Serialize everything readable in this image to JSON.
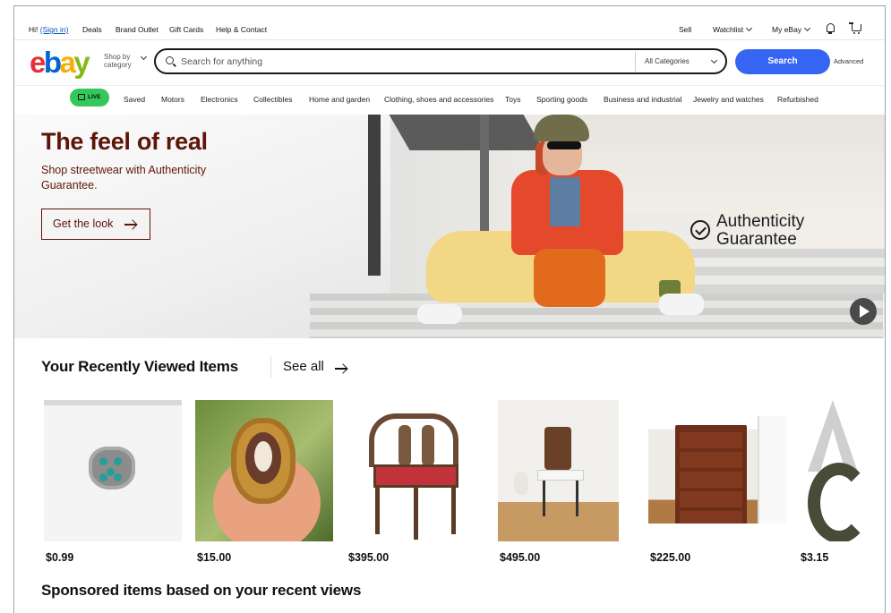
{
  "topbar": {
    "greeting": "Hi!",
    "signin": "(Sign in)",
    "deals": "Deals",
    "brand_outlet": "Brand Outlet",
    "gift_cards": "Gift Cards",
    "help": "Help & Contact",
    "sell": "Sell",
    "watchlist": "Watchlist",
    "my_ebay": "My eBay",
    "bell_icon": "bell-icon",
    "cart_icon": "cart-icon"
  },
  "header": {
    "logo": {
      "e": "e",
      "b": "b",
      "a": "a",
      "y": "y"
    },
    "shop_by_line1": "Shop by",
    "shop_by_line2": "category",
    "search_placeholder": "Search for anything",
    "search_value": "",
    "category_selected": "All Categories",
    "search_button": "Search",
    "advanced": "Advanced"
  },
  "nav": {
    "live": "LIVE",
    "items": [
      "Saved",
      "Motors",
      "Electronics",
      "Collectibles",
      "Home and garden",
      "Clothing, shoes and accessories",
      "Toys",
      "Sporting goods",
      "Business and industrial",
      "Jewelry and watches",
      "Refurbished"
    ]
  },
  "hero": {
    "title": "The feel of real",
    "subtitle": "Shop streetwear with Authenticity Guarantee.",
    "cta": "Get the look",
    "badge_line1": "Authenticity",
    "badge_line2": "Guarantee",
    "colors": {
      "title": "#5c1507"
    }
  },
  "recently_viewed": {
    "title": "Your Recently Viewed Items",
    "see_all": "See all",
    "items": [
      {
        "price": "$0.99"
      },
      {
        "price": "$15.00"
      },
      {
        "price": "$395.00"
      },
      {
        "price": "$495.00"
      },
      {
        "price": "$225.00"
      },
      {
        "price": "$3.15"
      }
    ]
  },
  "sponsored": {
    "title": "Sponsored items based on your recent views"
  },
  "colors": {
    "accent": "#3665f3",
    "live": "#34c759"
  }
}
